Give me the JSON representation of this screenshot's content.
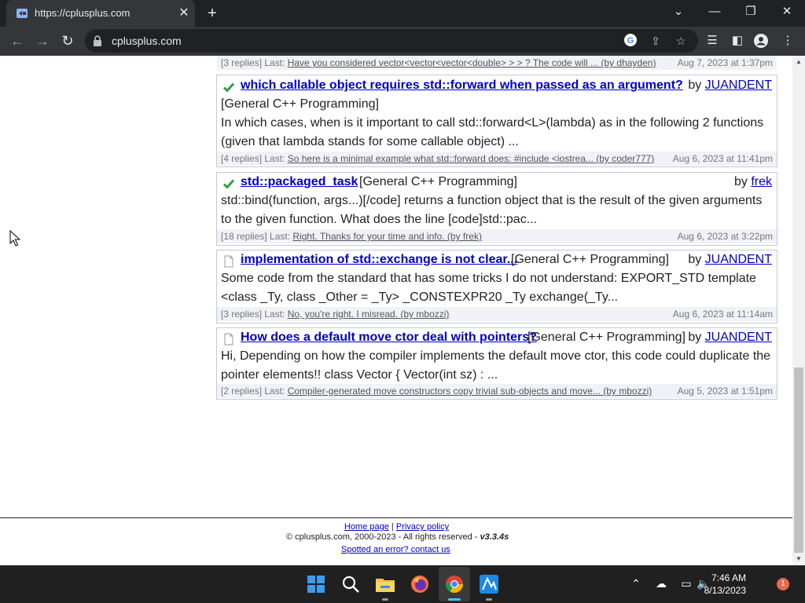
{
  "browser": {
    "tab_title": "https://cplusplus.com",
    "url": "cplusplus.com",
    "new_tab": "+",
    "close_tab": "✕"
  },
  "topics": [
    {
      "footer_left_prefix": "[3 replies] Last: ",
      "footer_left_link": "Have you considered vector<vector<vector<double> > > ? The code will ... (by dhayden)",
      "footer_date": "Aug 7, 2023 at 1:37pm"
    },
    {
      "icon": "check-icon",
      "title": "which callable object requires std::forward when passed as an argument?",
      "category": "[General C++ Programming]",
      "by_prefix": "by ",
      "author": "JUANDENT",
      "body": "In which cases, when is it important to call std::forward<L>(lambda) as in the following 2 functions (given that lambda stands for some callable object) ...",
      "footer_left_prefix": "[4 replies] Last: ",
      "footer_left_link": "So here is a minimal example what std::forward does: #include <iostrea... (by coder777)",
      "footer_date": "Aug 6, 2023 at 11:41pm"
    },
    {
      "icon": "check-icon",
      "title": "std::packaged_task",
      "category": "[General C++ Programming]",
      "by_prefix": "by ",
      "author": "frek",
      "body": "std::bind(function, args...)[/code] returns a function object that is the result of the given arguments to the given function. What does the line [code]std::pac...",
      "footer_left_prefix": "[18 replies] Last: ",
      "footer_left_link": "Right. Thanks for your time and info. (by frek)",
      "footer_date": "Aug 6, 2023 at 3:22pm"
    },
    {
      "icon": "document-icon",
      "title": "implementation of std::exchange is not clear...",
      "category": "[General C++ Programming]",
      "by_prefix": "by ",
      "author": "JUANDENT",
      "body": "Some code from the standard that has some tricks I do not understand: EXPORT_STD template <class _Ty, class _Other = _Ty> _CONSTEXPR20 _Ty exchange(_Ty...",
      "footer_left_prefix": "[3 replies] Last: ",
      "footer_left_link": "No, you're right. I misread. (by mbozzi)",
      "footer_date": "Aug 6, 2023 at 11:14am"
    },
    {
      "icon": "document-icon",
      "title": "How does a default move ctor deal with pointers?",
      "category": "[General C++ Programming]",
      "by_prefix": "by ",
      "author": "JUANDENT",
      "body": "Hi, Depending on how the compiler implements the default move ctor, this code could duplicate the pointer elements!! class Vector { Vector(int sz) : ...",
      "footer_left_prefix": "[2 replies] Last: ",
      "footer_left_link": "Compiler-generated move constructors copy trivial sub-objects and move... (by mbozzi)",
      "footer_date": "Aug 5, 2023 at 1:51pm"
    }
  ],
  "footer": {
    "home": "Home page",
    "sep": " | ",
    "privacy": "Privacy policy",
    "copyright": "© cplusplus.com, 2000-2023 - All rights reserved - ",
    "version": "v3.3.4s",
    "contact": "Spotted an error? contact us"
  },
  "taskbar": {
    "time": "7:46 AM",
    "date": "8/13/2023",
    "notification_count": "1"
  }
}
